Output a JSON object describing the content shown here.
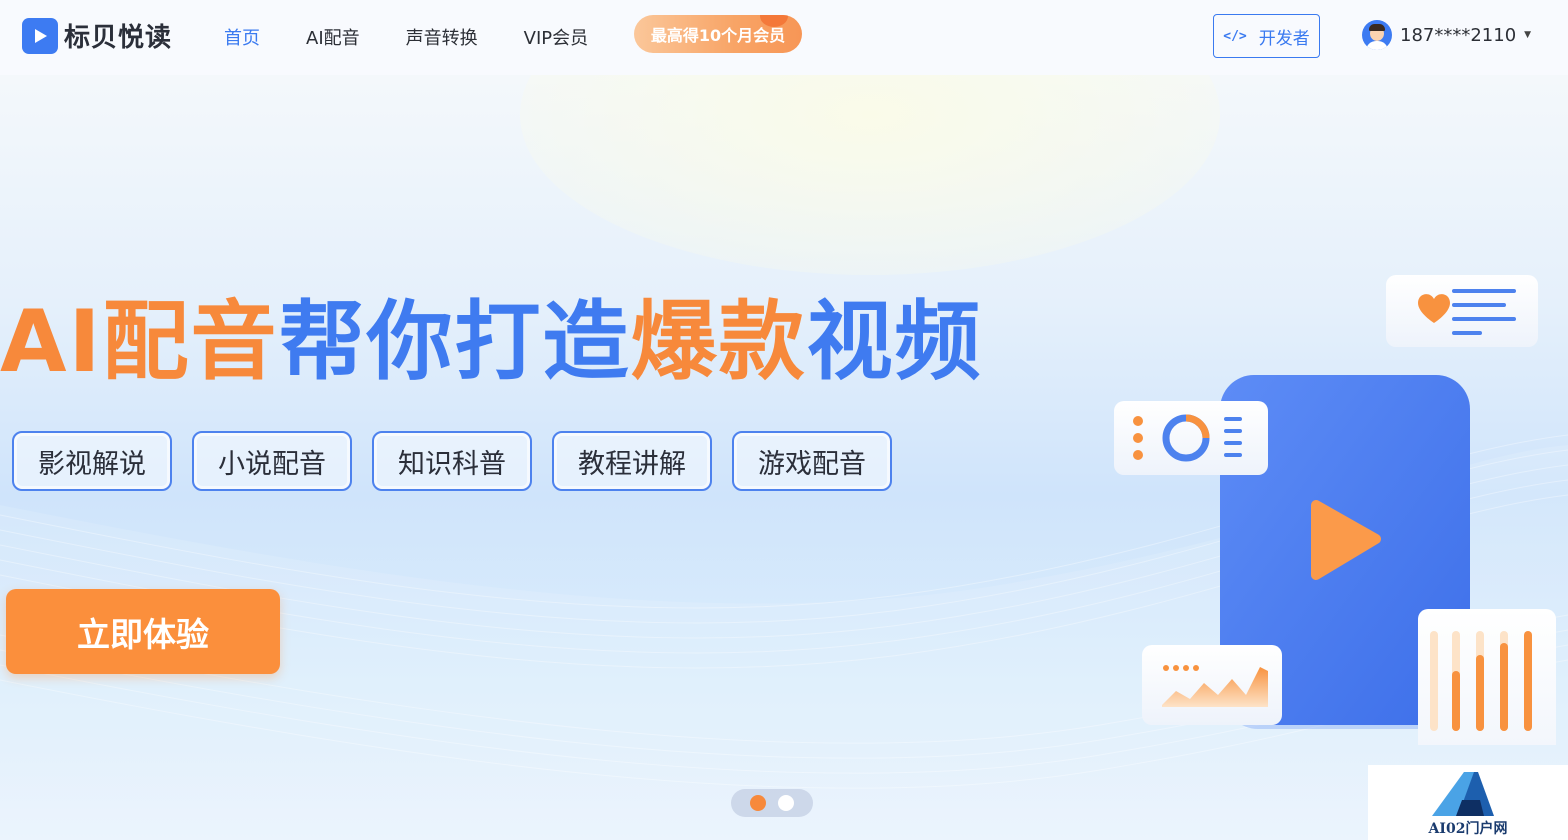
{
  "header": {
    "brand": "标贝悦读",
    "nav": [
      {
        "label": "首页",
        "active": true
      },
      {
        "label": "AI配音",
        "active": false
      },
      {
        "label": "声音转换",
        "active": false
      },
      {
        "label": "VIP会员",
        "active": false
      }
    ],
    "promo": "最高得10个月会员",
    "developer_button": "开发者",
    "developer_icon": "code-icon",
    "user": {
      "phone": "187****2110",
      "avatar_icon": "user-avatar-icon"
    }
  },
  "banner": {
    "headline_parts": [
      {
        "text": "AI配音",
        "color": "orange"
      },
      {
        "text": "帮你打造",
        "color": "blue"
      },
      {
        "text": "爆款",
        "color": "orange"
      },
      {
        "text": "视频",
        "color": "blue"
      }
    ],
    "tags": [
      "影视解说",
      "小说配音",
      "知识科普",
      "教程讲解",
      "游戏配音"
    ],
    "cta": "立即体验",
    "carousel": {
      "slides": 2,
      "active_index": 0
    }
  },
  "watermark": "AI02门户网",
  "colors": {
    "brand_blue": "#3f7bf0",
    "accent_orange": "#f7893b"
  }
}
